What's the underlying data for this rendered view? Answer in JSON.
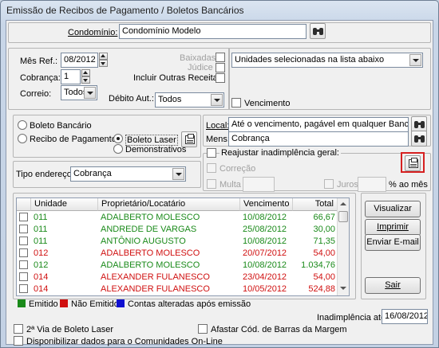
{
  "window": {
    "title": "Emissão de Recibos de Pagamento / Boletos Bancários"
  },
  "condominio": {
    "label": "Condomínio:",
    "value": "Condomínio Modelo"
  },
  "params": {
    "mes_ref_label": "Mês Ref.:",
    "mes_ref_value": "08/2012",
    "cobranca_label": "Cobrança:",
    "cobranca_value": "1",
    "correio_label": "Correio:",
    "correio_value": "Todos",
    "baixadas_label": "Baixadas",
    "judice_label": "Júdice",
    "incluir_label": "Incluir Outras Receitas",
    "debito_label": "Débito Aut.:",
    "debito_value": "Todos"
  },
  "unidades": {
    "value": "Unidades selecionadas na lista abaixo",
    "vencimento_label": "Vencimento"
  },
  "tipo": {
    "boleto_bancario": "Boleto Bancário",
    "recibo_pagamento": "Recibo de Pagamento",
    "boleto_laser": "Boleto Laser",
    "demonstrativos": "Demonstrativos",
    "selected": "boleto_laser"
  },
  "local": {
    "label": "Local:",
    "value": "Até o vencimento, pagável em qualquer Banco.",
    "mens_label": "Mens:",
    "mens_value": "Cobrança"
  },
  "reajustar": {
    "label": "Reajustar inadimplência geral:",
    "correcao": "Correção",
    "multa": "Multa",
    "juros": "Juros",
    "juros_suffix": "% ao mês"
  },
  "endereco": {
    "label": "Tipo endereço:",
    "value": "Cobrança"
  },
  "table": {
    "columns": [
      "Unidade",
      "Proprietário/Locatário",
      "Vencimento",
      "Total"
    ],
    "rows": [
      {
        "unidade": "011",
        "proprietario": "ADALBERTO MOLESCO",
        "vencimento": "10/08/2012",
        "total": "66,67",
        "color": "#1a8a1a"
      },
      {
        "unidade": "011",
        "proprietario": "ANDREDE DE VARGAS",
        "vencimento": "25/08/2012",
        "total": "30,00",
        "color": "#1a8a1a"
      },
      {
        "unidade": "011",
        "proprietario": "ANTÔNIO AUGUSTO",
        "vencimento": "10/08/2012",
        "total": "71,35",
        "color": "#1a8a1a"
      },
      {
        "unidade": "012",
        "proprietario": "ADALBERTO MOLESCO",
        "vencimento": "20/07/2012",
        "total": "54,00",
        "color": "#d01010"
      },
      {
        "unidade": "012",
        "proprietario": "ADALBERTO MOLESCO",
        "vencimento": "10/08/2012",
        "total": "1.034,76",
        "color": "#1a8a1a"
      },
      {
        "unidade": "014",
        "proprietario": "ALEXANDER FULANESCO",
        "vencimento": "23/04/2012",
        "total": "54,00",
        "color": "#d01010"
      },
      {
        "unidade": "014",
        "proprietario": "ALEXANDER FULANESCO",
        "vencimento": "10/05/2012",
        "total": "524,88",
        "color": "#d01010"
      }
    ]
  },
  "buttons": {
    "visualizar": "Visualizar",
    "imprimir": "Imprimir",
    "enviar_email": "Enviar E-mail",
    "sair": "Sair"
  },
  "legend": {
    "emitido": "Emitido",
    "nao_emitido": "Não Emitido",
    "contas_alteradas": "Contas alteradas após emissão",
    "colors": {
      "emitido": "#1a8a1a",
      "nao_emitido": "#d01010",
      "contas_alteradas": "#1010d0"
    }
  },
  "inadimplencia": {
    "label": "Inadimplência até:",
    "value": "16/08/2012"
  },
  "footer": {
    "segunda_via": "2ª Via de Boleto Laser",
    "afastar": "Afastar Cód. de Barras da Margem",
    "disponibilizar": "Disponibilizar dados para o Comunidades On-Line"
  }
}
